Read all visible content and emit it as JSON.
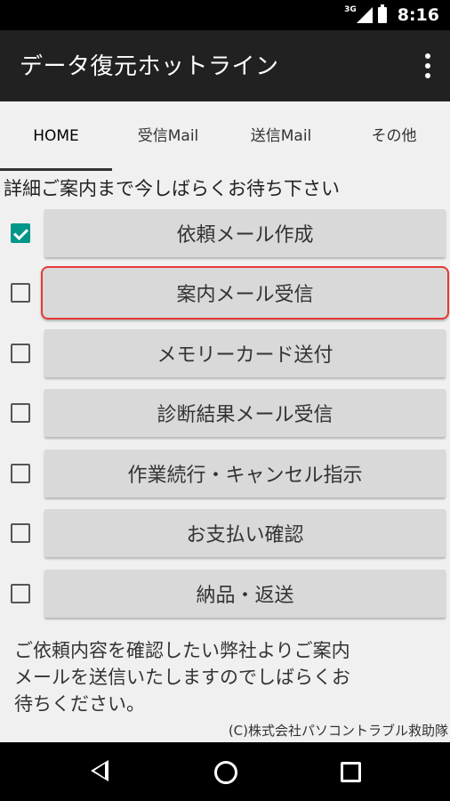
{
  "status_bar": {
    "network": "3G",
    "time": "8:16"
  },
  "app_bar": {
    "title": "データ復元ホットライン"
  },
  "tabs": [
    {
      "label": "HOME",
      "active": true
    },
    {
      "label": "受信Mail",
      "active": false
    },
    {
      "label": "送信Mail",
      "active": false
    },
    {
      "label": "その他",
      "active": false
    }
  ],
  "info_text": "詳細ご案内まで今しばらくお待ち下さい",
  "steps": [
    {
      "label": "依頼メール作成",
      "checked": true
    },
    {
      "label": "案内メール受信",
      "checked": false
    },
    {
      "label": "メモリーカード送付",
      "checked": false
    },
    {
      "label": "診断結果メール受信",
      "checked": false
    },
    {
      "label": "作業続行・キャンセル指示",
      "checked": false
    },
    {
      "label": "お支払い確認",
      "checked": false
    },
    {
      "label": "納品・返送",
      "checked": false
    }
  ],
  "note_lines": [
    "ご依頼内容を確認したい弊社よりご案内",
    "メールを送信いたしますのでしばらくお",
    "待ちください。"
  ],
  "copyright": "(C)株式会社パソコントラブル救助隊",
  "colors": {
    "check_accent": "#009688",
    "focus_border": "#e53935",
    "app_bar_bg": "#212121"
  }
}
